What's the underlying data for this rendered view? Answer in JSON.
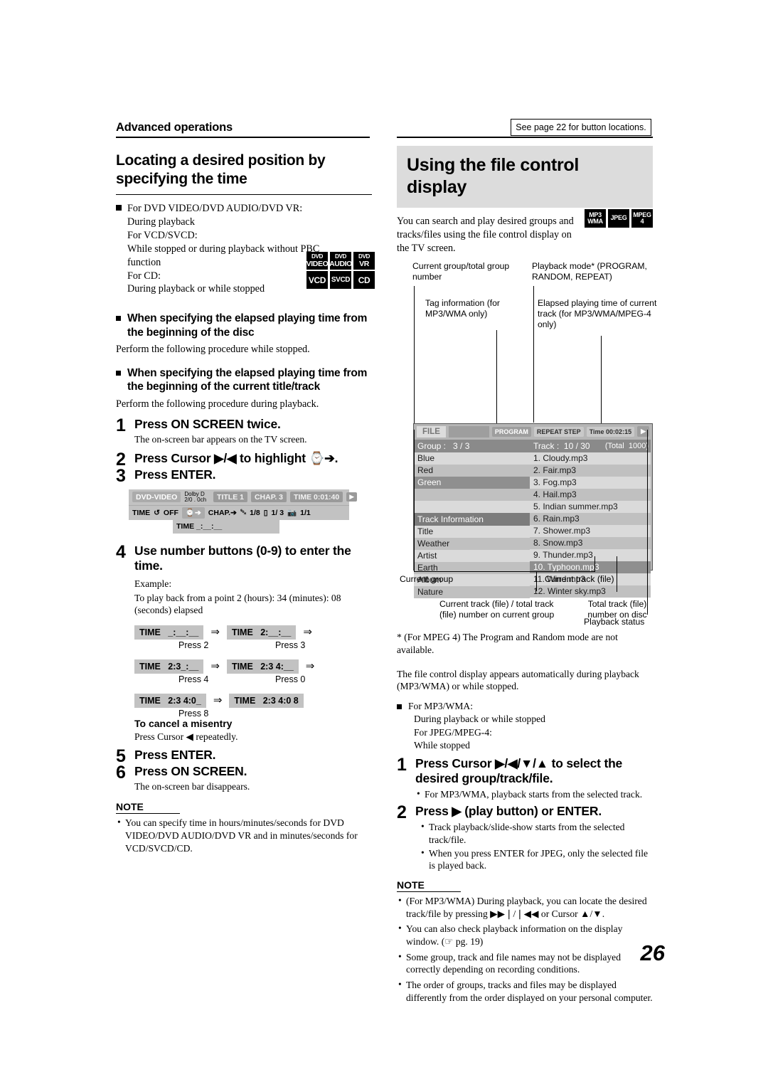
{
  "header": {
    "section_label": "Advanced operations",
    "see_page_note": "See page 22 for button locations."
  },
  "left_column": {
    "title": "Locating a desired position by specifying the time",
    "applicability": {
      "lines": [
        "For DVD VIDEO/DVD AUDIO/DVD VR:",
        "During playback",
        "For VCD/SVCD:",
        "While stopped or during playback without PBC",
        "function",
        "For CD:",
        "During playback or while stopped"
      ]
    },
    "disc_icons": [
      {
        "l1": "DVD",
        "l2": "VIDEO"
      },
      {
        "l1": "DVD",
        "l2": "AUDIO"
      },
      {
        "l1": "DVD",
        "l2": "VR"
      },
      {
        "l1": "VCD",
        "l2": ""
      },
      {
        "l1": "SVCD",
        "l2": ""
      },
      {
        "l1": "CD",
        "l2": ""
      }
    ],
    "subhead_1": "When specifying the elapsed playing time from the beginning of the disc",
    "subhead_1_body": "Perform the following procedure while stopped.",
    "subhead_2": "When specifying the elapsed playing time from the beginning of the current title/track",
    "subhead_2_body": "Perform the following procedure during playback.",
    "steps": [
      {
        "num": "1",
        "head": "Press ON SCREEN twice.",
        "sub": "The on-screen bar appears on the TV screen."
      },
      {
        "num": "2",
        "head": "Press Cursor ▶/◀ to highlight ⌚➔.",
        "sub": ""
      },
      {
        "num": "3",
        "head": "Press ENTER.",
        "sub": ""
      },
      {
        "num": "4",
        "head": "Use number buttons (0-9) to enter the time.",
        "sub": ""
      },
      {
        "num": "5",
        "head": "Press ENTER.",
        "sub": ""
      },
      {
        "num": "6",
        "head": "Press ON SCREEN.",
        "sub": "The on-screen bar disappears."
      }
    ],
    "osd_bar": {
      "disc_type": "DVD-VIDEO",
      "audio_line1": "Dolby D",
      "audio_line2": "2/0 . 0ch",
      "title_chip": "TITLE  1",
      "chap_chip": "CHAP.  3",
      "time_chip": "TIME    0:01:40",
      "play_chip": "▶",
      "row2": {
        "time_label": "TIME",
        "repeat_label": "OFF",
        "clock_item": "⌚➔",
        "chap_item": "CHAP.➔",
        "audio_item": "1/8",
        "subtitle_item": "1/ 3",
        "angle_item": "1/1"
      },
      "row3_label": "TIME   _:__:__"
    },
    "example": {
      "label": "Example:",
      "description": "To play back from a point 2 (hours): 34 (minutes): 08 (seconds) elapsed",
      "sequence": [
        {
          "box": "TIME   _:__:__",
          "press": "Press 2"
        },
        {
          "box": "TIME   2:__:__",
          "press": "Press 3"
        },
        {
          "box": "TIME   2:3_:__",
          "press": "Press 4"
        },
        {
          "box": "TIME   2:3 4:__",
          "press": "Press 0"
        },
        {
          "box": "TIME   2:3 4:0_",
          "press": "Press 8"
        },
        {
          "box": "TIME   2:3 4:0 8",
          "press": ""
        }
      ]
    },
    "cancel": {
      "head": "To cancel a misentry",
      "body": "Press Cursor ◀ repeatedly."
    },
    "note": {
      "head": "NOTE",
      "items": [
        "You can specify time in hours/minutes/seconds for DVD VIDEO/DVD AUDIO/DVD VR and in minutes/seconds for VCD/SVCD/CD."
      ]
    }
  },
  "right_column": {
    "title": "Using the file control display",
    "intro": "You can search and play desired groups and tracks/files using the file control display on the TV screen.",
    "format_icons": [
      {
        "l1": "MP3",
        "l2": "WMA"
      },
      {
        "l1": "JPEG",
        "l2": ""
      },
      {
        "l1": "MPEG",
        "l2": "4"
      }
    ],
    "callouts": {
      "current_group_total": "Current group/total group number",
      "playback_mode": "Playback mode* (PROGRAM, RANDOM, REPEAT)",
      "tag_information": "Tag information (for MP3/WMA only)",
      "elapsed_time": "Elapsed playing time of current track (for MP3/WMA/MPEG-4 only)",
      "current_group": "Current group",
      "current_track_file": "Current track (file)",
      "current_total_on_group": "Current track (file) / total track (file) number on current group",
      "total_on_disc": "Total track (file) number on disc",
      "playback_status": "Playback status"
    },
    "file_display": {
      "file_label": "FILE",
      "status_pills": [
        "PROGRAM",
        "REPEAT STEP",
        "Time 00:02:15"
      ],
      "play_pill": "▶",
      "group_header": "Group :   3 / 3",
      "groups": [
        "Blue",
        "Red",
        "Green",
        "",
        ""
      ],
      "selected_group": "Green",
      "track_info_header": "Track  Information",
      "track_info_rows": [
        "Title",
        "Weather",
        "Artist",
        "Earth",
        "Album",
        "Nature"
      ],
      "track_header": "Track :  10 / 30",
      "total_label": "(Total  1000)",
      "tracks": [
        "1. Cloudy.mp3",
        "2. Fair.mp3",
        "3. Fog.mp3",
        "4. Hail.mp3",
        "5. Indian summer.mp3",
        "6. Rain.mp3",
        "7. Shower.mp3",
        "8. Snow.mp3",
        "9. Thunder.mp3",
        "10. Typhoon.mp3",
        "11. Wind.mp3",
        "12. Winter sky.mp3"
      ],
      "selected_track": "10. Typhoon.mp3"
    },
    "footnote": "* (For MPEG 4) The Program and Random mode are not available.",
    "auto_display": "The file control display appears automatically during playback (MP3/WMA) or while stopped.",
    "availability": [
      "For MP3/WMA:",
      "During playback or while stopped",
      "For JPEG/MPEG-4:",
      "While stopped"
    ],
    "steps": [
      {
        "num": "1",
        "head": "Press Cursor ▶/◀/▼/▲ to select the desired group/track/file.",
        "bullets": [
          "For MP3/WMA, playback starts from the selected track."
        ]
      },
      {
        "num": "2",
        "head": "Press ▶ (play button) or ENTER.",
        "bullets": [
          "Track playback/slide-show starts from the selected track/file.",
          "When you press ENTER for JPEG, only the selected file is played back."
        ]
      }
    ],
    "note": {
      "head": "NOTE",
      "items": [
        "(For MP3/WMA) During playback, you can locate the desired track/file by pressing ▶▶❘/❘◀◀ or Cursor ▲/▼.",
        "You can also check playback information on the display window. (☞ pg. 19)",
        "Some group, track and file names may not be displayed correctly depending on recording conditions.",
        "The order of groups, tracks and files may be displayed differently from the order displayed on your personal computer."
      ]
    }
  },
  "page_number": "26"
}
